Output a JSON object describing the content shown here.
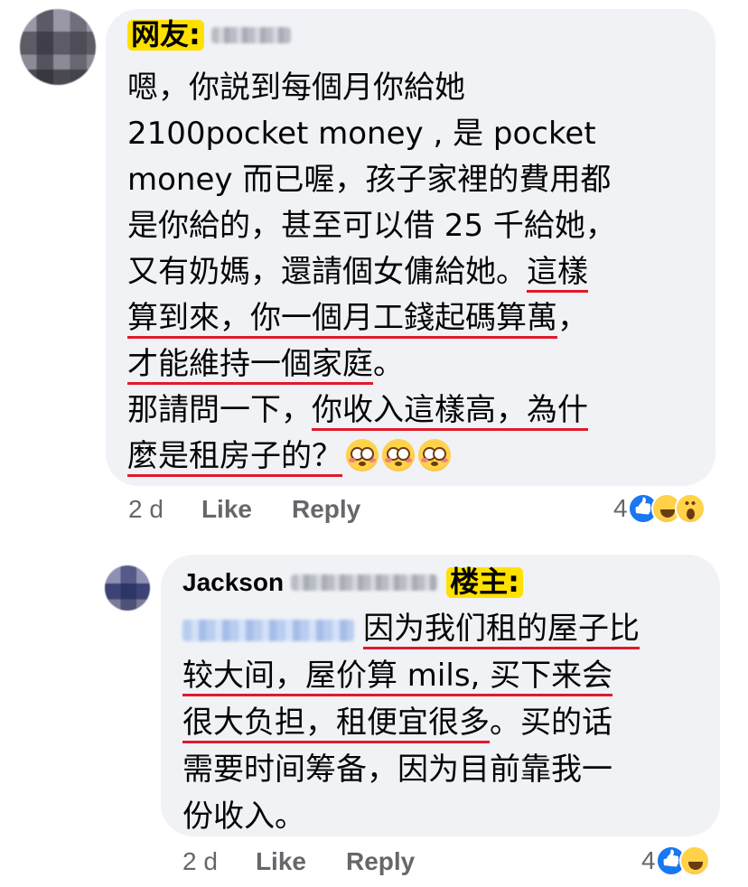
{
  "comment1": {
    "tag": "网友:",
    "lines": [
      [
        {
          "t": "嗯，你説到每個月你給她",
          "u": false
        }
      ],
      [
        {
          "t": "2100pocket money , 是 pocket",
          "u": false
        }
      ],
      [
        {
          "t": "money 而已喔，孩子家裡的費用都",
          "u": false
        }
      ],
      [
        {
          "t": "是你給的，甚至可以借 25 千給她，",
          "u": false
        }
      ],
      [
        {
          "t": "又有奶媽，還請個女傭給她。",
          "u": false
        },
        {
          "t": "這樣",
          "u": true
        }
      ],
      [
        {
          "t": "算到來，你一個月工錢起碼算萬",
          "u": true
        },
        {
          "t": "，",
          "u": false
        }
      ],
      [
        {
          "t": "才能維持一個家庭",
          "u": true
        },
        {
          "t": "。",
          "u": false
        }
      ],
      [
        {
          "t": "那請問一下，",
          "u": false
        },
        {
          "t": "你收入這樣高，為什",
          "u": true
        }
      ],
      [
        {
          "t": "麼是租房子的？",
          "u": true
        }
      ]
    ],
    "emoji": [
      "flushed-face-emoji",
      "flushed-face-emoji",
      "flushed-face-emoji"
    ],
    "time": "2 d",
    "like_label": "Like",
    "reply_label": "Reply",
    "reaction_count": "4",
    "reactions": [
      "like",
      "haha",
      "wow"
    ]
  },
  "comment2": {
    "author": "Jackson",
    "tag": "楼主:",
    "lines": [
      [
        {
          "t": "因为我们租的屋子比",
          "u": true
        }
      ],
      [
        {
          "t": "较大间，屋价算 mils, 买下来会",
          "u": true
        }
      ],
      [
        {
          "t": "很大负担，租便宜很多",
          "u": true
        },
        {
          "t": "。买的话",
          "u": false
        }
      ],
      [
        {
          "t": "需要时间筹备，因为目前靠我一",
          "u": false
        }
      ],
      [
        {
          "t": "份收入。",
          "u": false
        }
      ]
    ],
    "time": "2 d",
    "like_label": "Like",
    "reply_label": "Reply",
    "reaction_count": "4",
    "reactions": [
      "like",
      "haha"
    ]
  },
  "colors": {
    "bubble": "#f0f2f5",
    "underline": "#e0192d",
    "tag_highlight": "#ffe100",
    "meta_text": "#65676b",
    "like_blue": "#1877f2"
  }
}
